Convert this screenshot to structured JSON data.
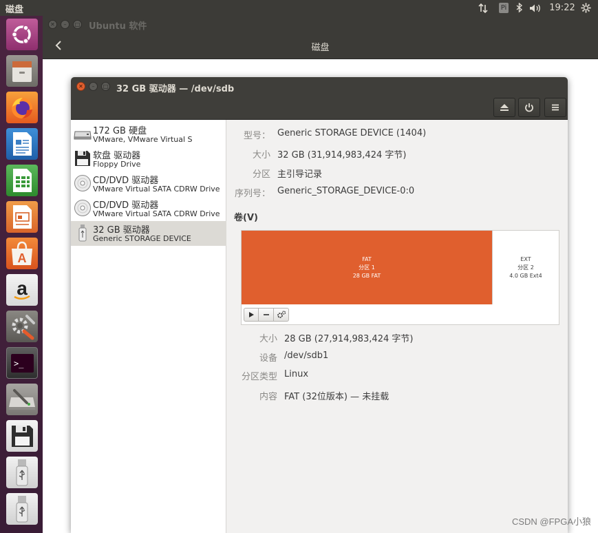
{
  "top_panel": {
    "app_name": "磁盘",
    "time": "19:22",
    "keyboard_indicator": "Pi",
    "icons": [
      "network-icon",
      "keyboard-icon",
      "bluetooth-icon",
      "volume-icon",
      "settings-gear-icon"
    ]
  },
  "launcher": {
    "items": [
      {
        "name": "ubuntu-dash-icon",
        "label": ""
      },
      {
        "name": "files-icon",
        "label": ""
      },
      {
        "name": "firefox-icon",
        "label": ""
      },
      {
        "name": "libreoffice-writer-icon",
        "label": ""
      },
      {
        "name": "libreoffice-calc-icon",
        "label": ""
      },
      {
        "name": "libreoffice-impress-icon",
        "label": ""
      },
      {
        "name": "ubuntu-software-icon",
        "label": "A"
      },
      {
        "name": "amazon-icon",
        "label": "a"
      },
      {
        "name": "system-settings-icon",
        "label": ""
      },
      {
        "name": "terminal-icon",
        "label": ">_"
      },
      {
        "name": "disks-icon",
        "label": ""
      },
      {
        "name": "floppy-icon",
        "label": ""
      },
      {
        "name": "usb-drive-icon",
        "label": ""
      },
      {
        "name": "usb-drive-icon-2",
        "label": ""
      }
    ]
  },
  "software_center": {
    "title": "Ubuntu 软件",
    "header_title": "磁盘"
  },
  "disks_window": {
    "title": "32 GB 驱动器 — /dev/sdb",
    "toolbar_icons": [
      "eject-icon",
      "power-icon",
      "menu-icon"
    ],
    "devices": [
      {
        "name": "172 GB 硬盘",
        "sub": "VMware, VMware Virtual S",
        "icon": "hard-disk-icon",
        "selected": false
      },
      {
        "name": "软盘 驱动器",
        "sub": "Floppy Drive",
        "icon": "floppy-icon",
        "selected": false
      },
      {
        "name": "CD/DVD 驱动器",
        "sub": "VMware Virtual SATA CDRW Drive",
        "icon": "optical-disc-icon",
        "selected": false
      },
      {
        "name": "CD/DVD 驱动器",
        "sub": "VMware Virtual SATA CDRW Drive",
        "icon": "optical-disc-icon",
        "selected": false
      },
      {
        "name": "32 GB 驱动器",
        "sub": "Generic STORAGE DEVICE",
        "icon": "usb-drive-icon",
        "selected": true
      }
    ],
    "drive_info": {
      "model_label": "型号：",
      "model_value": "Generic STORAGE DEVICE (1404)",
      "size_label": "大小",
      "size_value": "32 GB (31,914,983,424 字节)",
      "partitioning_label": "分区",
      "partitioning_value": "主引导记录",
      "serial_label": "序列号：",
      "serial_value": "Generic_STORAGE_DEVICE-0:0"
    },
    "volumes": {
      "heading": "卷(V)",
      "segments": [
        {
          "fs": "FAT",
          "partition": "分区 1",
          "desc": "28 GB FAT",
          "share": 0.79,
          "color": "#e05f2e"
        },
        {
          "fs": "EXT",
          "partition": "分区 2",
          "desc": "4.0 GB Ext4",
          "share": 0.21,
          "color": "#ffffff"
        }
      ],
      "tool_buttons": [
        "mount-play-icon",
        "delete-partition-icon",
        "partition-settings-gears-icon"
      ]
    },
    "partition_info": {
      "size_label": "大小",
      "size_value": "28 GB (27,914,983,424 字节)",
      "device_label": "设备",
      "device_value": "/dev/sdb1",
      "type_label": "分区类型",
      "type_value": "Linux",
      "contents_label": "内容",
      "contents_value": "FAT (32位版本) — 未挂载"
    }
  },
  "watermark": "CSDN @FPGA小狼"
}
